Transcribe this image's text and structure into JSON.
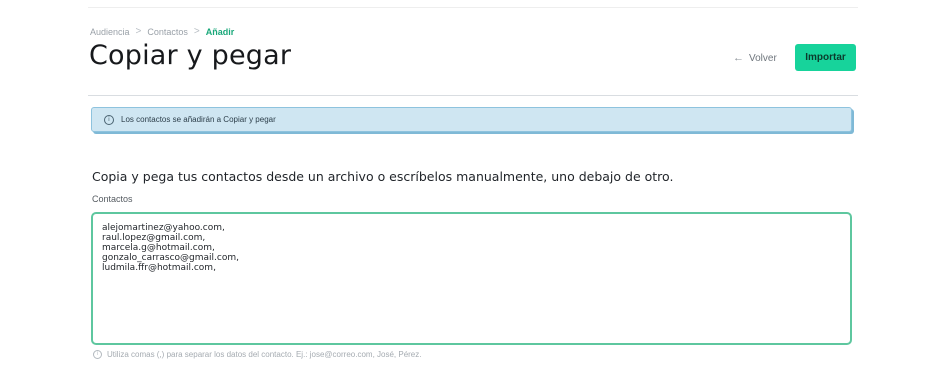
{
  "breadcrumb": {
    "items": [
      "Audiencia",
      "Contactos",
      "Añadir"
    ],
    "separator": ">"
  },
  "header": {
    "title": "Copiar y pegar",
    "back_label": "Volver",
    "back_arrow": "←",
    "import_label": "Importar"
  },
  "banner": {
    "icon": "info-icon",
    "text": "Los contactos se añadirán a Copiar y pegar"
  },
  "form": {
    "intro": "Copia y pega tus contactos desde un archivo o escríbelos manualmente, uno debajo de otro.",
    "contacts_label": "Contactos",
    "contacts_value": "alejomartinez@yahoo.com,\nraul.lopez@gmail.com,\nmarcela.g@hotmail.com,\ngonzalo_carrasco@gmail.com,\nludmila.ffr@hotmail.com,",
    "help_icon": "info-icon",
    "help_text": "Utiliza comas (,) para separar los datos del contacto. Ej.: jose@correo.com, José, Pérez."
  },
  "colors": {
    "accent": "#17d39b",
    "breadcrumb_current": "#1aa87a",
    "banner_bg": "#cfe6f2",
    "banner_border": "#8ec3de",
    "textarea_border": "#5ec79f"
  }
}
